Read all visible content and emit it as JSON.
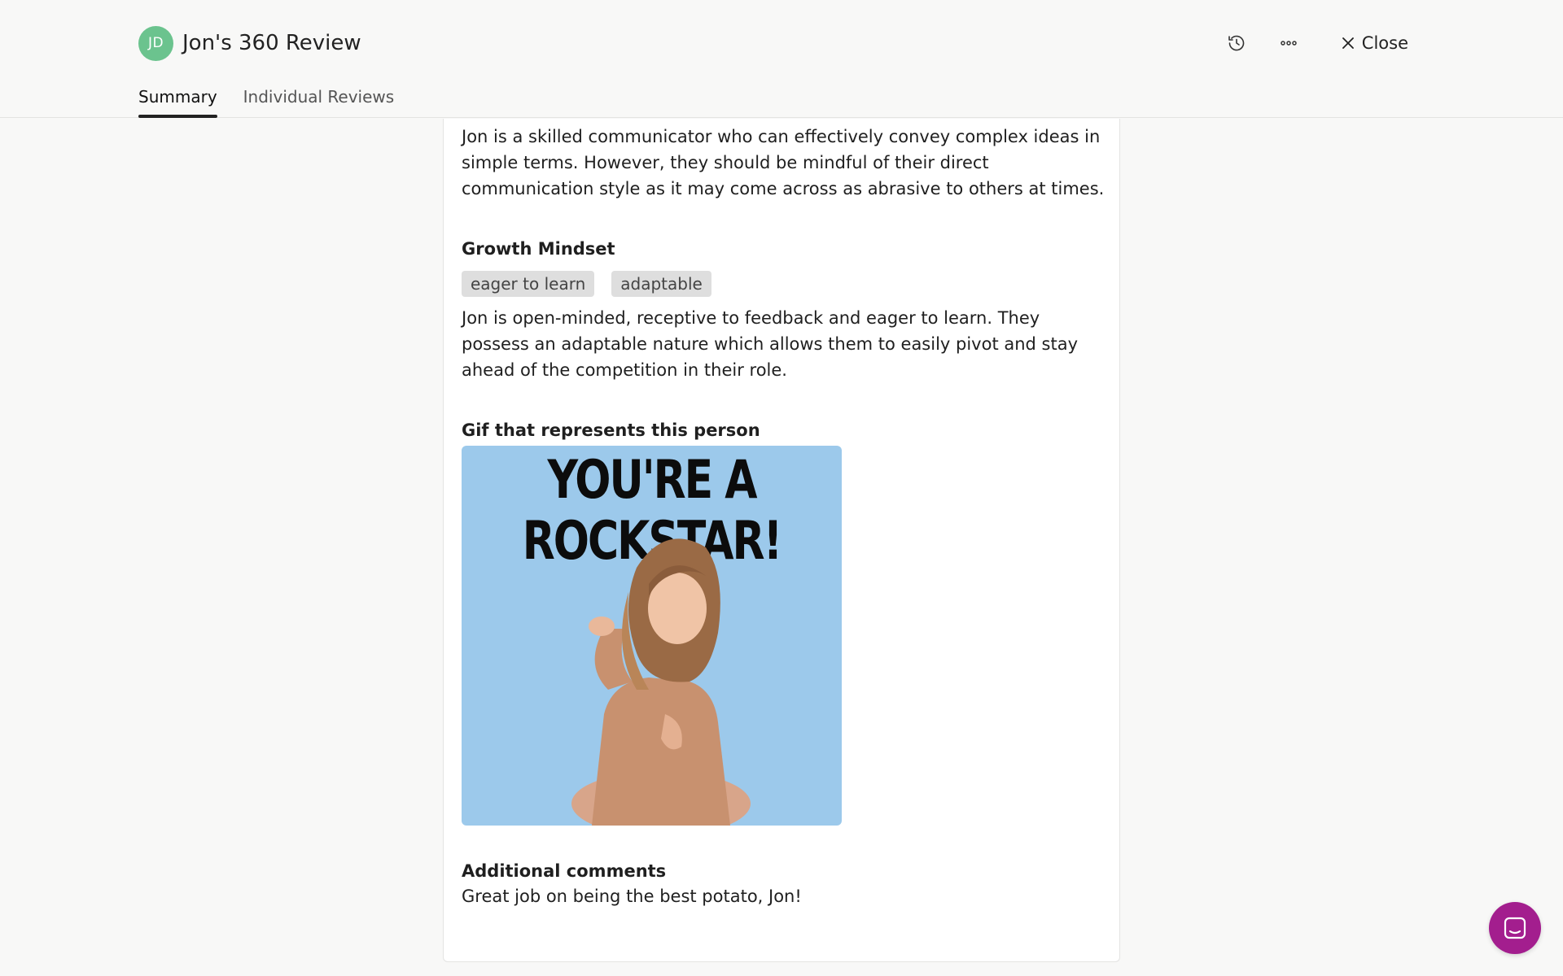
{
  "header": {
    "avatar_initials": "JD",
    "title": "Jon's 360 Review",
    "close_label": "Close",
    "history_icon": "history-icon",
    "more_icon": "more-options-icon"
  },
  "tabs": [
    {
      "label": "Summary",
      "active": true
    },
    {
      "label": "Individual Reviews",
      "active": false
    }
  ],
  "review": {
    "communication_text": "Jon is a skilled communicator who can effectively convey complex ideas in simple terms. However, they should be mindful of their direct communication style as it may come across as abrasive to others at times.",
    "growth": {
      "title": "Growth Mindset",
      "tags": [
        "eager to learn",
        "adaptable"
      ],
      "text": "Jon is open-minded, receptive to feedback and eager to learn. They possess an adaptable nature which allows them to easily pivot and stay ahead of the competition in their role."
    },
    "gif": {
      "title": "Gif that represents this person",
      "caption": "YOU'RE A ROCKSTAR!"
    },
    "comments": {
      "title": "Additional comments",
      "text": "Great job on being the best potato, Jon!"
    }
  },
  "colors": {
    "avatar": "#6bc38e",
    "chat_button": "#a31e8e",
    "gif_background": "#9cc9eb"
  }
}
